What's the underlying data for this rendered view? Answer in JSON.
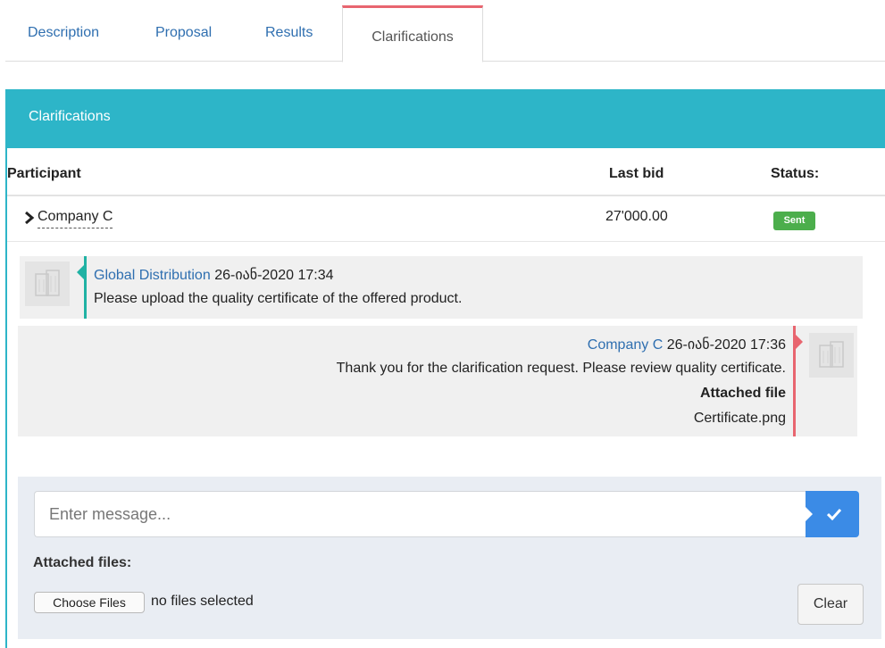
{
  "tabs": [
    {
      "label": "Description"
    },
    {
      "label": "Proposal"
    },
    {
      "label": "Results"
    },
    {
      "label": "Clarifications",
      "active": true
    }
  ],
  "panel": {
    "title": "Clarifications",
    "columns": {
      "participant": "Participant",
      "last_bid": "Last bid",
      "status": "Status:"
    }
  },
  "row": {
    "participant": "Company C",
    "last_bid": "27'000.00",
    "status": "Sent"
  },
  "messages": [
    {
      "sender": "Global Distribution",
      "timestamp": "26-იან-2020 17:34",
      "text": "Please upload the quality certificate of the offered product.",
      "side": "left"
    },
    {
      "sender": "Company C",
      "timestamp": "26-იან-2020 17:36",
      "text": "Thank you for the clarification request. Please review quality certificate.",
      "attached_label": "Attached file",
      "attachment": "Certificate.png",
      "side": "right"
    }
  ],
  "composer": {
    "placeholder": "Enter message...",
    "attached_files_label": "Attached files:",
    "choose_files_label": "Choose Files",
    "file_status": "no files selected",
    "clear_label": "Clear",
    "send_icon": "check-icon"
  },
  "colors": {
    "accent": "#2db5c8",
    "link": "#2f6fb0",
    "active_tab_border": "#e8656f",
    "sent_badge": "#4cae4c",
    "send_button": "#3b8be6",
    "left_message_bar": "#20b2a4",
    "right_message_bar": "#e8656f"
  }
}
